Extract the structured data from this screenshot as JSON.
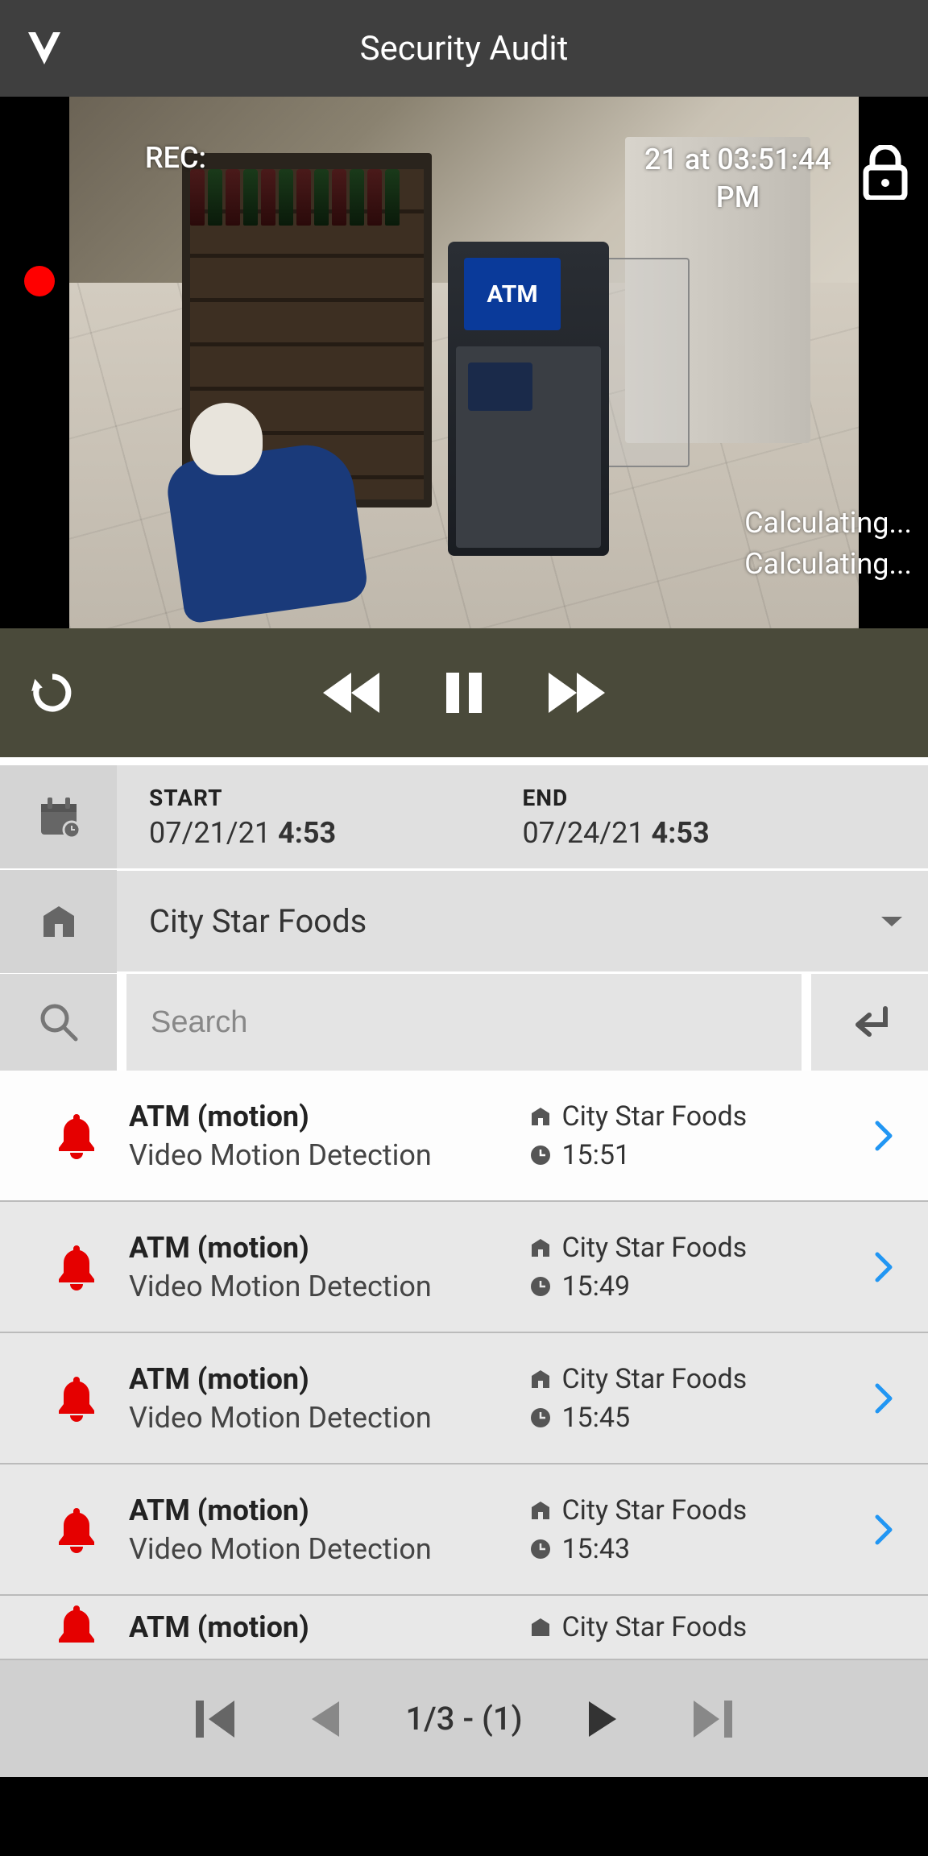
{
  "header": {
    "title": "Security Audit"
  },
  "video": {
    "rec_label": "REC:",
    "timestamp_line1": "21 at 03:51:44",
    "timestamp_line2": "PM",
    "calc1": "Calculating...",
    "calc2": "Calculating...",
    "atm_label": "ATM"
  },
  "date_filter": {
    "start_label": "START",
    "start_date": "07/21/21",
    "start_time": "4:53",
    "end_label": "END",
    "end_date": "07/24/21",
    "end_time": "4:53"
  },
  "site": {
    "name": "City Star Foods"
  },
  "search": {
    "placeholder": "Search"
  },
  "events": [
    {
      "title": "ATM (motion)",
      "sub": "Video Motion Detection",
      "site": "City Star Foods",
      "time": "15:51",
      "selected": true
    },
    {
      "title": "ATM (motion)",
      "sub": "Video Motion Detection",
      "site": "City Star Foods",
      "time": "15:49",
      "selected": false
    },
    {
      "title": "ATM (motion)",
      "sub": "Video Motion Detection",
      "site": "City Star Foods",
      "time": "15:45",
      "selected": false
    },
    {
      "title": "ATM (motion)",
      "sub": "Video Motion Detection",
      "site": "City Star Foods",
      "time": "15:43",
      "selected": false
    },
    {
      "title": "ATM (motion)",
      "sub": "",
      "site": "City Star Foods",
      "time": "",
      "selected": false
    }
  ],
  "pager": {
    "text": "1/3 - (1)"
  },
  "colors": {
    "alert": "#e50000",
    "accent": "#2196f3"
  }
}
